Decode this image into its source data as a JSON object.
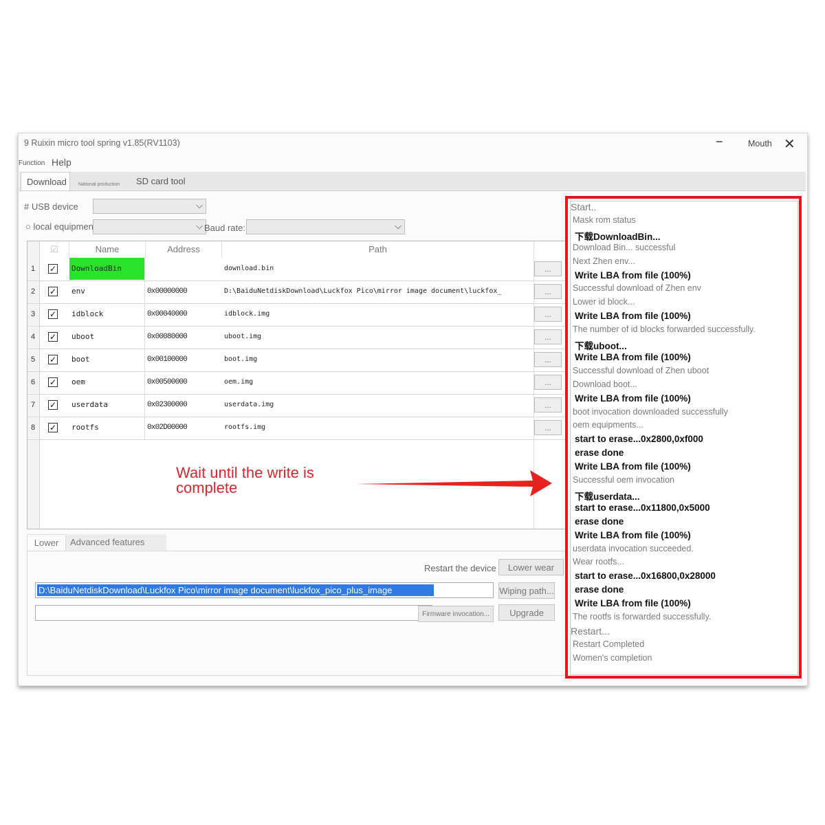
{
  "window": {
    "title": "9 Ruixin micro tool spring v1.85(RV1103)",
    "minimize": "−",
    "maximize_label": "Mouth",
    "close": "✕"
  },
  "menu": {
    "function_label": "Function",
    "help_label": "Help"
  },
  "tabs": {
    "download": "Download",
    "national": "National production",
    "sdcard": "SD card tool"
  },
  "device": {
    "usb_label": "# USB device",
    "local_label": "○ local equipment",
    "baud_label": "Baud rate:"
  },
  "grid": {
    "headers": {
      "name": "Name",
      "address": "Address",
      "path": "Path"
    },
    "dots": "...",
    "rows": [
      {
        "num": "1",
        "checked": true,
        "name": "DownloadBin",
        "address": "",
        "path": "download.bin",
        "highlight": true
      },
      {
        "num": "2",
        "checked": true,
        "name": "env",
        "address": "0x00000000",
        "path": "D:\\BaiduNetdiskDownload\\Luckfox Pico\\mirror image document\\luckfox_"
      },
      {
        "num": "3",
        "checked": true,
        "name": "idblock",
        "address": "0x00040000",
        "path": "idblock.img"
      },
      {
        "num": "4",
        "checked": true,
        "name": "uboot",
        "address": "0x00080000",
        "path": "uboot.img"
      },
      {
        "num": "5",
        "checked": true,
        "name": "boot",
        "address": "0x00100000",
        "path": "boot.img"
      },
      {
        "num": "6",
        "checked": true,
        "name": "oem",
        "address": "0x00500000",
        "path": "oem.img"
      },
      {
        "num": "7",
        "checked": true,
        "name": "userdata",
        "address": "0x02300000",
        "path": "userdata.img"
      },
      {
        "num": "8",
        "checked": true,
        "name": "rootfs",
        "address": "0x02D00000",
        "path": "rootfs.img"
      }
    ]
  },
  "annotation": {
    "line1": "Wait until the write is",
    "line2": "complete",
    "color": "#d9262a"
  },
  "bottom": {
    "tab_lower": "Lower",
    "tab_advanced": "Advanced features",
    "restart_label": "Restart the device",
    "lower_wear_button": "Lower wear",
    "path_value": "D:\\BaiduNetdiskDownload\\Luckfox Pico\\mirror image document\\luckfox_pico_plus_image",
    "wiping_button": "Wiping path...",
    "firmware_button": "Firmware invocation...",
    "upgrade_button": "Upgrade"
  },
  "log": {
    "border_color": "#e8161b",
    "lines": [
      {
        "text": "Start..",
        "style": "normal"
      },
      {
        "text": "Mask rom status",
        "style": "normal"
      },
      {
        "text": "下载DownloadBin...",
        "style": "dark"
      },
      {
        "text": "Download Bin... successful",
        "style": "normal"
      },
      {
        "text": "Next Zhen env...",
        "style": "normal"
      },
      {
        "text": "Write LBA from file (100%)",
        "style": "dark"
      },
      {
        "text": "Successful download of Zhen env",
        "style": "normal"
      },
      {
        "text": "Lower id block...",
        "style": "normal"
      },
      {
        "text": "Write LBA from file (100%)",
        "style": "dark"
      },
      {
        "text": "The number of id blocks forwarded successfully.",
        "style": "normal"
      },
      {
        "text": "下载uboot...",
        "style": "dark"
      },
      {
        "text": "Write LBA from file (100%)",
        "style": "dark"
      },
      {
        "text": "Successful download of Zhen uboot",
        "style": "normal"
      },
      {
        "text": "Download boot...",
        "style": "normal"
      },
      {
        "text": "Write LBA from file (100%)",
        "style": "dark"
      },
      {
        "text": "boot invocation downloaded successfully",
        "style": "normal"
      },
      {
        "text": "oem equipments...",
        "style": "normal"
      },
      {
        "text": "start to erase...0x2800,0xf000",
        "style": "dark"
      },
      {
        "text": "erase done",
        "style": "dark"
      },
      {
        "text": "Write LBA from file (100%)",
        "style": "dark"
      },
      {
        "text": "Successful oem invocation",
        "style": "normal"
      },
      {
        "text": "下载userdata...",
        "style": "dark"
      },
      {
        "text": "start to erase...0x11800,0x5000",
        "style": "dark"
      },
      {
        "text": "erase done",
        "style": "dark"
      },
      {
        "text": "Write LBA from file (100%)",
        "style": "dark"
      },
      {
        "text": "userdata invocation succeeded.",
        "style": "normal"
      },
      {
        "text": "Wear rootfs...",
        "style": "normal"
      },
      {
        "text": "start to erase...0x16800,0x28000",
        "style": "dark"
      },
      {
        "text": "erase done",
        "style": "dark"
      },
      {
        "text": "Write LBA from file (100%)",
        "style": "dark"
      },
      {
        "text": "The rootfs is forwarded successfully.",
        "style": "normal"
      },
      {
        "text": "Restart...",
        "style": "normal"
      },
      {
        "text": "Restart Completed",
        "style": "normal"
      },
      {
        "text": "Women's completion",
        "style": "normal"
      }
    ]
  }
}
